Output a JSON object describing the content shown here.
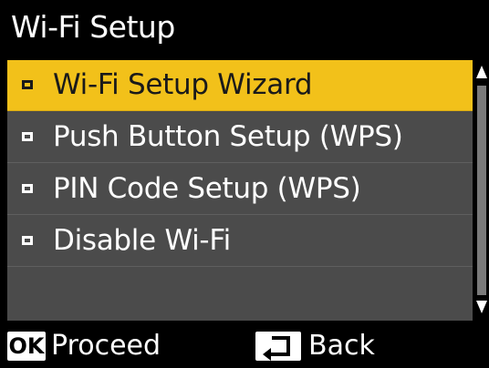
{
  "header": {
    "title": "Wi-Fi Setup"
  },
  "menu": {
    "selected_index": 0,
    "items": [
      {
        "label": "Wi-Fi Setup Wizard"
      },
      {
        "label": "Push Button Setup (WPS)"
      },
      {
        "label": "PIN Code Setup (WPS)"
      },
      {
        "label": "Disable Wi-Fi"
      }
    ]
  },
  "footer": {
    "ok_key": "OK",
    "ok_label": "Proceed",
    "back_icon": "back-arrow-icon",
    "back_label": "Back"
  },
  "colors": {
    "background": "#000000",
    "menu_bg": "#4b4b4b",
    "selected_bg": "#f2c11a",
    "text": "#ffffff",
    "selected_text": "#1a1a1a"
  }
}
